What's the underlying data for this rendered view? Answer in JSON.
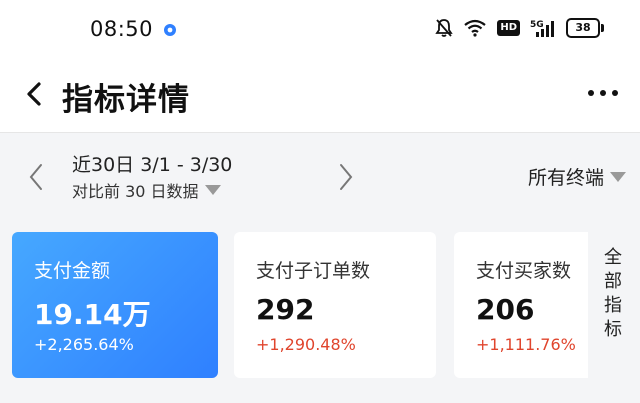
{
  "status_bar": {
    "time": "08:50",
    "network": "5G",
    "hd": "HD",
    "battery": "38"
  },
  "header": {
    "title": "指标详情"
  },
  "filter": {
    "range": "近30日 3/1 - 3/30",
    "compare": "对比前 30 日数据",
    "terminal": "所有终端"
  },
  "metrics": [
    {
      "label": "支付金额",
      "value": "19.14万",
      "change": "+2,265.64%"
    },
    {
      "label": "支付子订单数",
      "value": "292",
      "change": "+1,290.48%"
    },
    {
      "label": "支付买家数",
      "value": "206",
      "change": "+1,111.76%"
    }
  ],
  "all_metrics_label": "全部指标",
  "colors": {
    "accent": "#2f80ff",
    "increase_red": "#e0452d",
    "background": "#f4f5f7"
  }
}
